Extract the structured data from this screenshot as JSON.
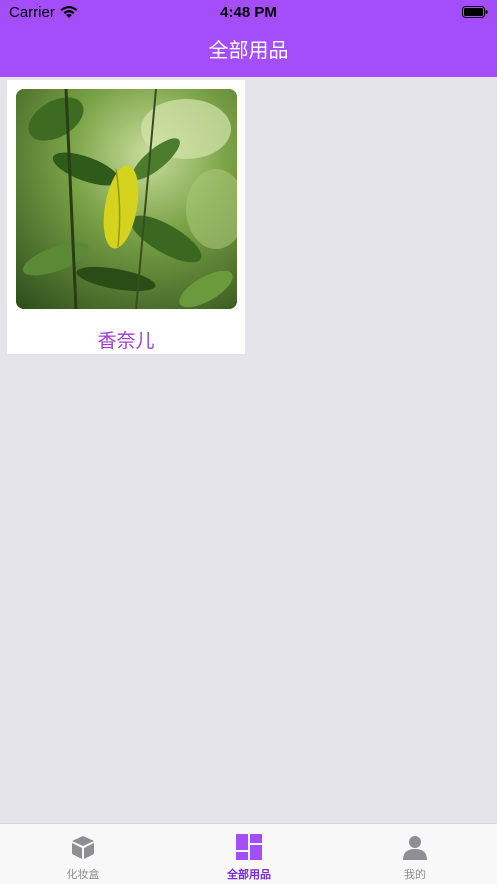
{
  "status_bar": {
    "carrier": "Carrier",
    "time": "4:48 PM"
  },
  "header": {
    "title": "全部用品",
    "background": "#a44dfa"
  },
  "items": [
    {
      "name": "香奈儿",
      "image": "green-leaves-photo"
    }
  ],
  "tabbar": {
    "tabs": [
      {
        "label": "化妆盒",
        "icon": "box-icon",
        "active": false
      },
      {
        "label": "全部用品",
        "icon": "grid-icon",
        "active": true
      },
      {
        "label": "我的",
        "icon": "person-icon",
        "active": false
      }
    ],
    "active_color": "#a44dfa",
    "inactive_color": "#8e8e93"
  }
}
